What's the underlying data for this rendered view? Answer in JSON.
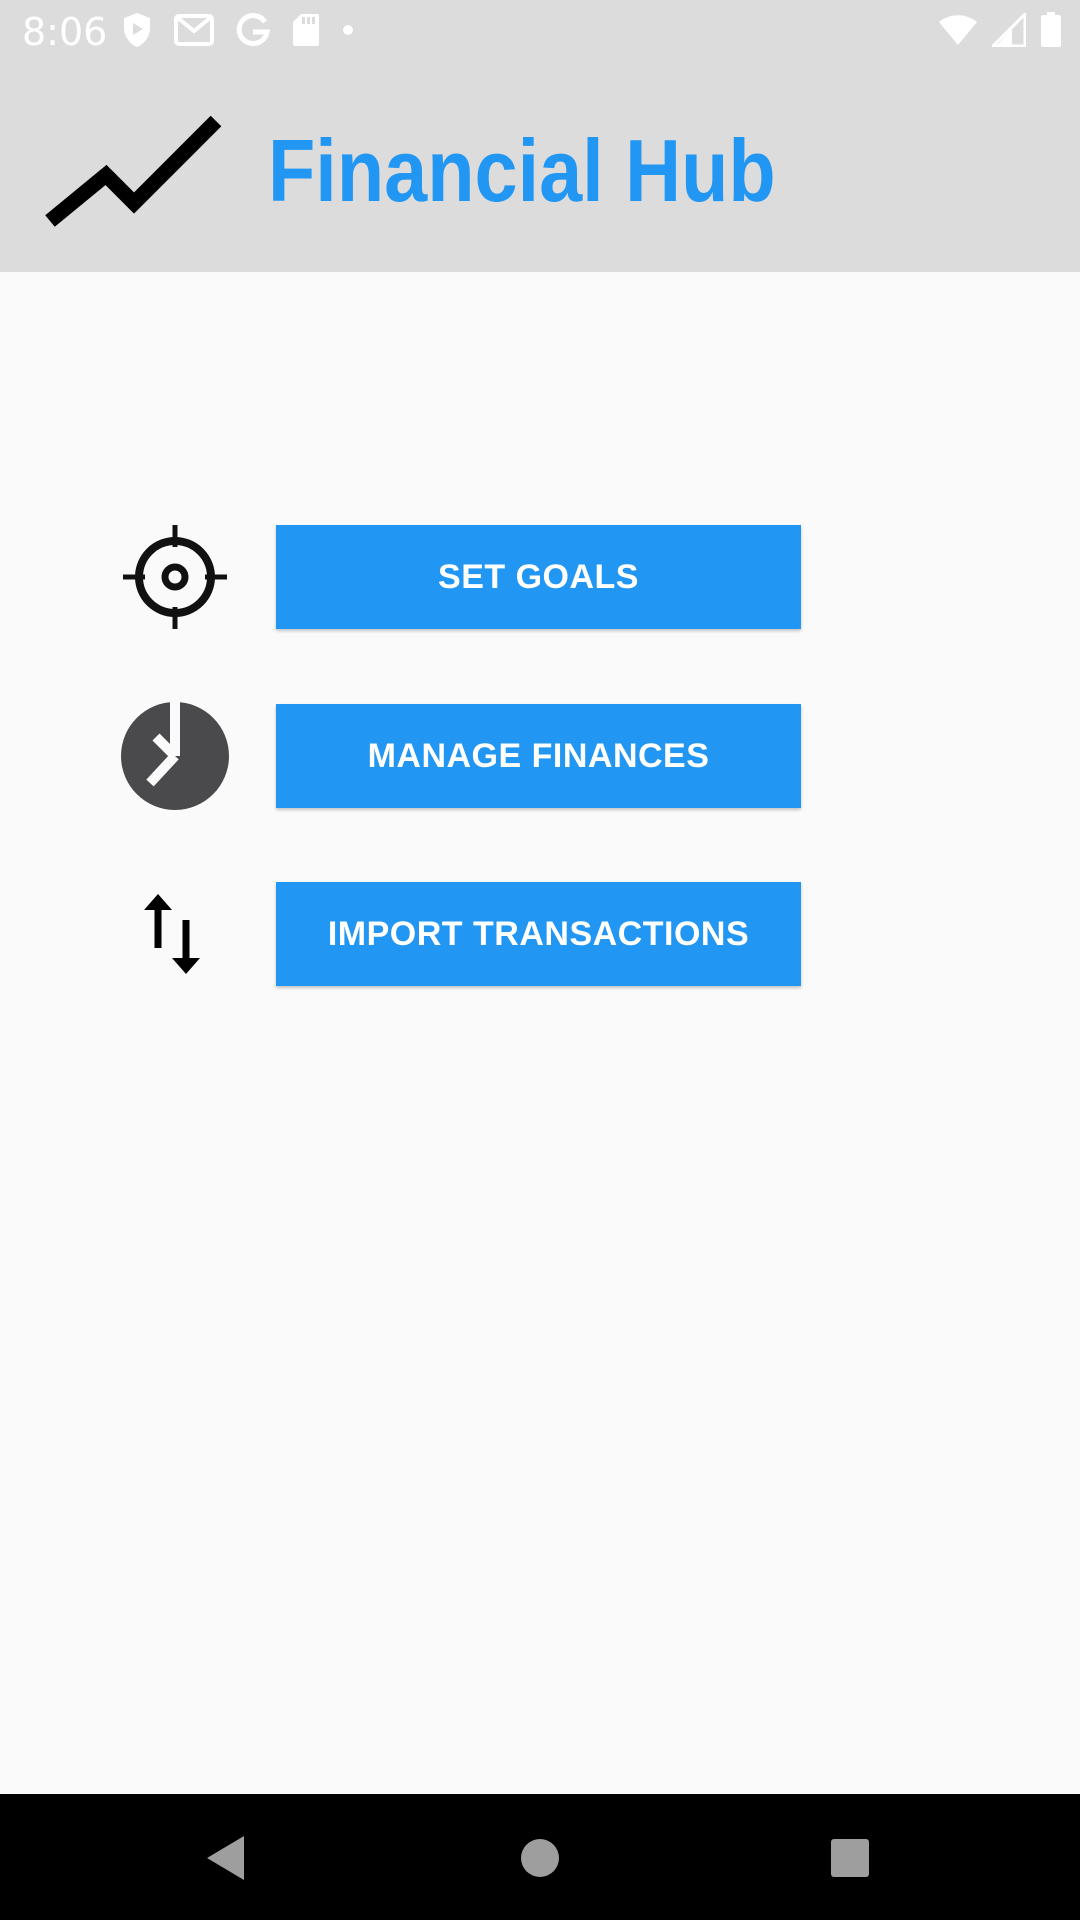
{
  "status_bar": {
    "time": "8:06",
    "left_icons": [
      "shield-icon",
      "gmail-icon",
      "google-icon",
      "sd-card-icon",
      "dot-icon"
    ],
    "right_icons": [
      "wifi-icon",
      "signal-icon",
      "battery-icon"
    ]
  },
  "app_bar": {
    "title": "Financial Hub",
    "logo_icon": "trend-line-icon",
    "title_color": "#2196f3"
  },
  "menu": {
    "items": [
      {
        "label": "SET GOALS",
        "icon": "target-icon"
      },
      {
        "label": "MANAGE FINANCES",
        "icon": "pie-chart-icon"
      },
      {
        "label": "IMPORT TRANSACTIONS",
        "icon": "swap-vertical-icon"
      }
    ],
    "button_color": "#2196f3"
  },
  "nav_bar": {
    "buttons": [
      "back-icon",
      "home-icon",
      "recents-icon"
    ]
  }
}
